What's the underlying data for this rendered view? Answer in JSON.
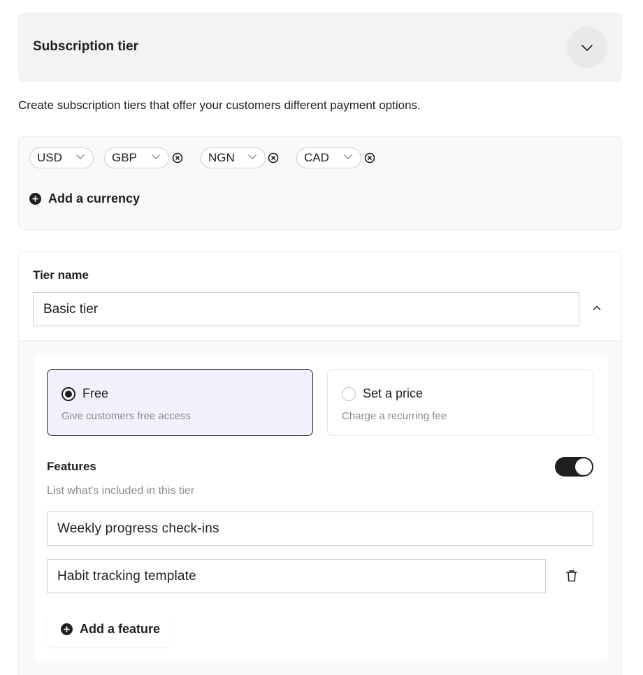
{
  "header": {
    "title": "Subscription tier"
  },
  "description": "Create subscription tiers that offer your customers different payment options.",
  "currencies": [
    {
      "code": "USD",
      "removable": false
    },
    {
      "code": "GBP",
      "removable": true
    },
    {
      "code": "NGN",
      "removable": true
    },
    {
      "code": "CAD",
      "removable": true
    }
  ],
  "add_currency_label": "Add a currency",
  "tier": {
    "name_label": "Tier name",
    "name_value": "Basic tier",
    "pricing": {
      "free": {
        "title": "Free",
        "desc": "Give customers free access",
        "selected": true
      },
      "paid": {
        "title": "Set a price",
        "desc": "Charge a recurring fee",
        "selected": false
      }
    },
    "features_label": "Features",
    "features_enabled": true,
    "features_help": "List what's included in this tier",
    "features": [
      "Weekly progress check-ins",
      "Habit tracking template"
    ],
    "add_feature_label": "Add a feature"
  },
  "colors": {
    "selected_bg": "#f1f0fd",
    "dark": "#1f1f1f",
    "muted": "#8a8a8a"
  }
}
